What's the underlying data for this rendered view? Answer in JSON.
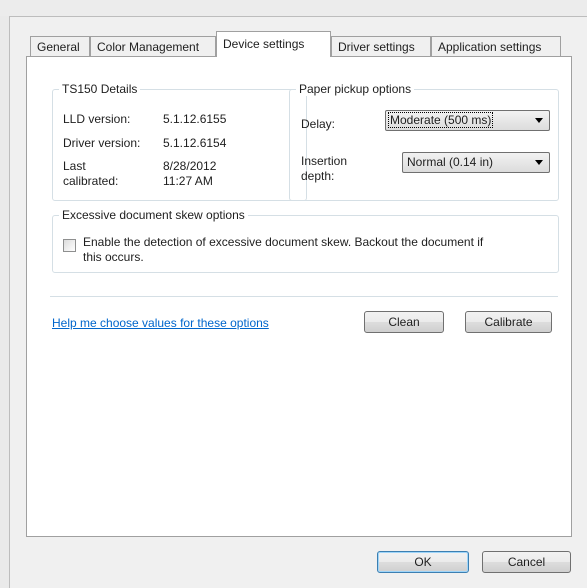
{
  "tabs": [
    {
      "label": "General",
      "active": false
    },
    {
      "label": "Color Management",
      "active": false
    },
    {
      "label": "Device settings",
      "active": true
    },
    {
      "label": "Driver settings",
      "active": false
    },
    {
      "label": "Application settings",
      "active": false
    }
  ],
  "details": {
    "title": "TS150 Details",
    "lld_label": "LLD version:",
    "lld_value": "5.1.12.6155",
    "driver_label": "Driver version:",
    "driver_value": "5.1.12.6154",
    "calibrated_label_line1": "Last",
    "calibrated_label_line2": "calibrated:",
    "calibrated_date": "8/28/2012",
    "calibrated_time": "11:27 AM"
  },
  "pickup": {
    "title": "Paper pickup options",
    "delay_label": "Delay:",
    "delay_value": "Moderate (500 ms)",
    "insertion_label_line1": "Insertion",
    "insertion_label_line2": "depth:",
    "insertion_value": "Normal (0.14 in)"
  },
  "skew": {
    "title": "Excessive document skew options",
    "checkbox_line1": "Enable the detection of excessive document skew. Backout the document if",
    "checkbox_line2": "this occurs.",
    "checked": false
  },
  "help_link": "Help me choose values for these options",
  "buttons": {
    "clean": "Clean",
    "calibrate": "Calibrate",
    "ok": "OK",
    "cancel": "Cancel"
  },
  "colors": {
    "link": "#0066cc",
    "panel_background": "#ffffff",
    "dialog_background": "#f0f0f0"
  }
}
